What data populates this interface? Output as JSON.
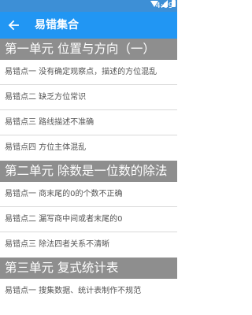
{
  "status_bar": {
    "time": "4:09",
    "icons": [
      "wifi-icon",
      "signal-icon",
      "battery-icon"
    ]
  },
  "app_bar": {
    "back_icon": "arrow-back-icon",
    "title": "易错集合"
  },
  "colors": {
    "status_bar": "#3d8fd6",
    "app_bar": "#2196f3",
    "section_header": "#8e8e8e"
  },
  "sections": [
    {
      "title": "第一单元 位置与方向（一）",
      "items": [
        "易错点一 没有确定观察点，描述的方位混乱",
        "易错点二 缺乏方位常识",
        "易错点三 路线描述不准确",
        "易错点四 方位主体混乱"
      ]
    },
    {
      "title": "第二单元 除数是一位数的除法",
      "items": [
        "易错点一 商末尾的0的个数不正确",
        "易错点二 漏写商中间或者末尾的0",
        "易错点三 除法四者关系不清晰"
      ]
    },
    {
      "title": "第三单元 复式统计表",
      "items": [
        "易错点一 搜集数据、统计表制作不规范"
      ]
    }
  ]
}
